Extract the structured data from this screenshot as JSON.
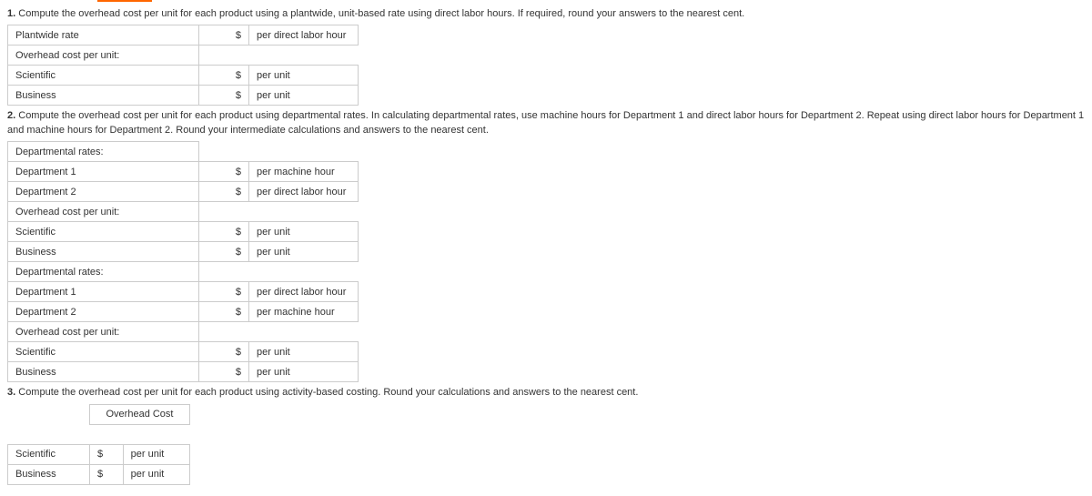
{
  "q1": {
    "prefix": "1.",
    "text": " Compute the overhead cost per unit for each product using a plantwide, unit-based rate using direct labor hours. If required, round your answers to the nearest cent.",
    "rows": [
      {
        "label": "Plantwide rate",
        "sym": "$",
        "unit": "per direct labor hour"
      },
      {
        "label": "Overhead cost per unit:",
        "sym": "",
        "unit": ""
      },
      {
        "label": "Scientific",
        "sym": "$",
        "unit": "per unit"
      },
      {
        "label": "Business",
        "sym": "$",
        "unit": "per unit"
      }
    ]
  },
  "q2": {
    "prefix": "2.",
    "text": " Compute the overhead cost per unit for each product using departmental rates. In calculating departmental rates, use machine hours for Department 1 and direct labor hours for Department 2. Repeat using direct labor hours for Department 1 and machine hours for Department 2. Round your intermediate calculations and answers to the nearest cent.",
    "rows": [
      {
        "label": "Departmental rates:",
        "sym": "",
        "unit": ""
      },
      {
        "label": "Department 1",
        "sym": "$",
        "unit": "per machine hour"
      },
      {
        "label": "Department 2",
        "sym": "$",
        "unit": "per direct labor hour"
      },
      {
        "label": "Overhead cost per unit:",
        "sym": "",
        "unit": ""
      },
      {
        "label": "Scientific",
        "sym": "$",
        "unit": "per unit"
      },
      {
        "label": "Business",
        "sym": "$",
        "unit": "per unit"
      },
      {
        "label": "Departmental rates:",
        "sym": "",
        "unit": ""
      },
      {
        "label": "Department 1",
        "sym": "$",
        "unit": "per direct labor hour"
      },
      {
        "label": "Department 2",
        "sym": "$",
        "unit": "per machine hour"
      },
      {
        "label": "Overhead cost per unit:",
        "sym": "",
        "unit": ""
      },
      {
        "label": "Scientific",
        "sym": "$",
        "unit": "per unit"
      },
      {
        "label": "Business",
        "sym": "$",
        "unit": "per unit"
      }
    ]
  },
  "q3": {
    "prefix": "3.",
    "text": " Compute the overhead cost per unit for each product using activity-based costing. Round your calculations and answers to the nearest cent.",
    "header": "Overhead Cost",
    "rows": [
      {
        "label": "Scientific",
        "sym": "$",
        "unit": "per unit"
      },
      {
        "label": "Business",
        "sym": "$",
        "unit": "per unit"
      }
    ]
  }
}
